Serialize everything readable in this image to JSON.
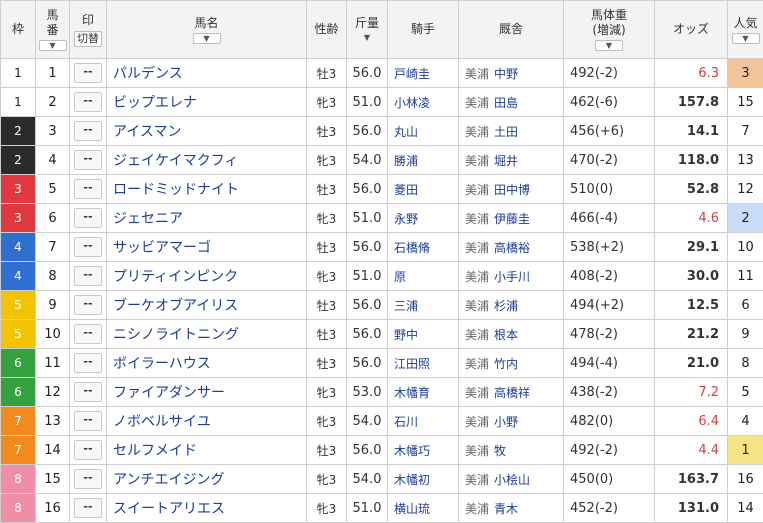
{
  "headers": {
    "waku": "枠",
    "umaban_line1": "馬",
    "umaban_line2": "番",
    "mark": "印",
    "mark_toggle": "切替",
    "horse": "馬名",
    "sexage": "性齢",
    "weight": "斤量",
    "jockey": "騎手",
    "trainer": "厩舎",
    "bw_line1": "馬体重",
    "bw_line2": "(増減)",
    "odds": "オッズ",
    "pop": "人気",
    "sort_glyph": "▼"
  },
  "colors": {
    "waku1": "#ffffff",
    "waku2": "#2b2b2b",
    "waku3": "#e0383f",
    "waku4": "#2f6fd0",
    "waku5": "#f2c400",
    "waku6": "#36a23f",
    "waku7": "#f28a1d",
    "waku8": "#ef8ea6",
    "fav1": "#f6e386",
    "fav2": "#c9dcfa",
    "fav3": "#f3c399",
    "odds_red": "#d34040"
  },
  "rows": [
    {
      "waku": "1",
      "umaban": "1",
      "mark": "--",
      "horse": "パルデンス",
      "sexage": "牡3",
      "weight": "56.0",
      "jockey": "戸崎圭",
      "area": "美浦",
      "trainer": "中野",
      "bw": "492(-2)",
      "odds": "6.3",
      "pop": "3"
    },
    {
      "waku": "1",
      "umaban": "2",
      "mark": "--",
      "horse": "ビップエレナ",
      "sexage": "牝3",
      "weight": "51.0",
      "jockey": "小林凌",
      "area": "美浦",
      "trainer": "田島",
      "bw": "462(-6)",
      "odds": "157.8",
      "pop": "15"
    },
    {
      "waku": "2",
      "umaban": "3",
      "mark": "--",
      "horse": "アイスマン",
      "sexage": "牡3",
      "weight": "56.0",
      "jockey": "丸山",
      "area": "美浦",
      "trainer": "土田",
      "bw": "456(+6)",
      "odds": "14.1",
      "pop": "7"
    },
    {
      "waku": "2",
      "umaban": "4",
      "mark": "--",
      "horse": "ジェイケイマクフィ",
      "sexage": "牝3",
      "weight": "54.0",
      "jockey": "勝浦",
      "area": "美浦",
      "trainer": "堀井",
      "bw": "470(-2)",
      "odds": "118.0",
      "pop": "13"
    },
    {
      "waku": "3",
      "umaban": "5",
      "mark": "--",
      "horse": "ロードミッドナイト",
      "sexage": "牡3",
      "weight": "56.0",
      "jockey": "菱田",
      "area": "美浦",
      "trainer": "田中博",
      "bw": "510(0)",
      "odds": "52.8",
      "pop": "12"
    },
    {
      "waku": "3",
      "umaban": "6",
      "mark": "--",
      "horse": "ジェセニア",
      "sexage": "牝3",
      "weight": "51.0",
      "jockey": "永野",
      "area": "美浦",
      "trainer": "伊藤圭",
      "bw": "466(-4)",
      "odds": "4.6",
      "pop": "2"
    },
    {
      "waku": "4",
      "umaban": "7",
      "mark": "--",
      "horse": "サッビアマーゴ",
      "sexage": "牡3",
      "weight": "56.0",
      "jockey": "石橋脩",
      "area": "美浦",
      "trainer": "高橋裕",
      "bw": "538(+2)",
      "odds": "29.1",
      "pop": "10"
    },
    {
      "waku": "4",
      "umaban": "8",
      "mark": "--",
      "horse": "プリティインピンク",
      "sexage": "牝3",
      "weight": "51.0",
      "jockey": "原",
      "area": "美浦",
      "trainer": "小手川",
      "bw": "408(-2)",
      "odds": "30.0",
      "pop": "11"
    },
    {
      "waku": "5",
      "umaban": "9",
      "mark": "--",
      "horse": "ブーケオブアイリス",
      "sexage": "牡3",
      "weight": "56.0",
      "jockey": "三浦",
      "area": "美浦",
      "trainer": "杉浦",
      "bw": "494(+2)",
      "odds": "12.5",
      "pop": "6"
    },
    {
      "waku": "5",
      "umaban": "10",
      "mark": "--",
      "horse": "ニシノライトニング",
      "sexage": "牡3",
      "weight": "56.0",
      "jockey": "野中",
      "area": "美浦",
      "trainer": "根本",
      "bw": "478(-2)",
      "odds": "21.2",
      "pop": "9"
    },
    {
      "waku": "6",
      "umaban": "11",
      "mark": "--",
      "horse": "ボイラーハウス",
      "sexage": "牡3",
      "weight": "56.0",
      "jockey": "江田照",
      "area": "美浦",
      "trainer": "竹内",
      "bw": "494(-4)",
      "odds": "21.0",
      "pop": "8"
    },
    {
      "waku": "6",
      "umaban": "12",
      "mark": "--",
      "horse": "ファイアダンサー",
      "sexage": "牝3",
      "weight": "53.0",
      "jockey": "木幡育",
      "area": "美浦",
      "trainer": "高橋祥",
      "bw": "438(-2)",
      "odds": "7.2",
      "pop": "5"
    },
    {
      "waku": "7",
      "umaban": "13",
      "mark": "--",
      "horse": "ノボベルサイユ",
      "sexage": "牝3",
      "weight": "54.0",
      "jockey": "石川",
      "area": "美浦",
      "trainer": "小野",
      "bw": "482(0)",
      "odds": "6.4",
      "pop": "4"
    },
    {
      "waku": "7",
      "umaban": "14",
      "mark": "--",
      "horse": "セルフメイド",
      "sexage": "牡3",
      "weight": "56.0",
      "jockey": "木幡巧",
      "area": "美浦",
      "trainer": "牧",
      "bw": "492(-2)",
      "odds": "4.4",
      "pop": "1"
    },
    {
      "waku": "8",
      "umaban": "15",
      "mark": "--",
      "horse": "アンチエイジング",
      "sexage": "牝3",
      "weight": "54.0",
      "jockey": "木幡初",
      "area": "美浦",
      "trainer": "小桧山",
      "bw": "450(0)",
      "odds": "163.7",
      "pop": "16"
    },
    {
      "waku": "8",
      "umaban": "16",
      "mark": "--",
      "horse": "スイートアリエス",
      "sexage": "牝3",
      "weight": "51.0",
      "jockey": "横山琉",
      "area": "美浦",
      "trainer": "青木",
      "bw": "452(-2)",
      "odds": "131.0",
      "pop": "14"
    }
  ]
}
